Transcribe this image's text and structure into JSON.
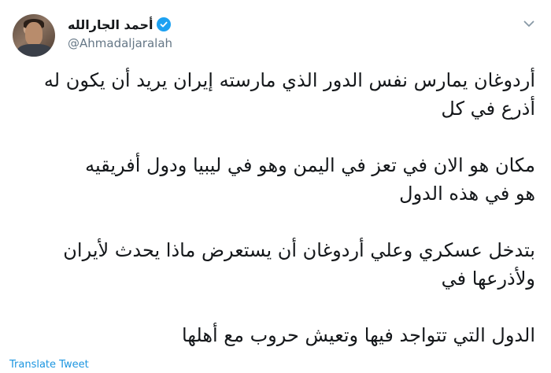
{
  "author": {
    "display_name": "أحمد الجارالله",
    "handle": "@Ahmadaljaralah",
    "verified": true
  },
  "icons": {
    "avatar": "profile-photo",
    "verified": "verified-badge-icon",
    "menu": "chevron-down-icon"
  },
  "tweet": {
    "lines": [
      "أردوغان يمارس نفس الدور الذي مارسته إيران يريد أن يكون له",
      "أذرع في كل",
      "مكان هو الان في تعز في اليمن وهو  في ليبيا ودول أفريقيه",
      "هو في هذه الدول",
      "بتدخل عسكري  وعلي أردوغان أن يستعرض  ماذا يحدث لأيران",
      "ولأذرعها في",
      "الدول التي تتواجد فيها وتعيش حروب مع أهلها"
    ]
  },
  "actions": {
    "translate_label": "Translate Tweet"
  },
  "colors": {
    "text": "#14171a",
    "secondary": "#657786",
    "link": "#1b95e0",
    "verified": "#1da1f2"
  }
}
